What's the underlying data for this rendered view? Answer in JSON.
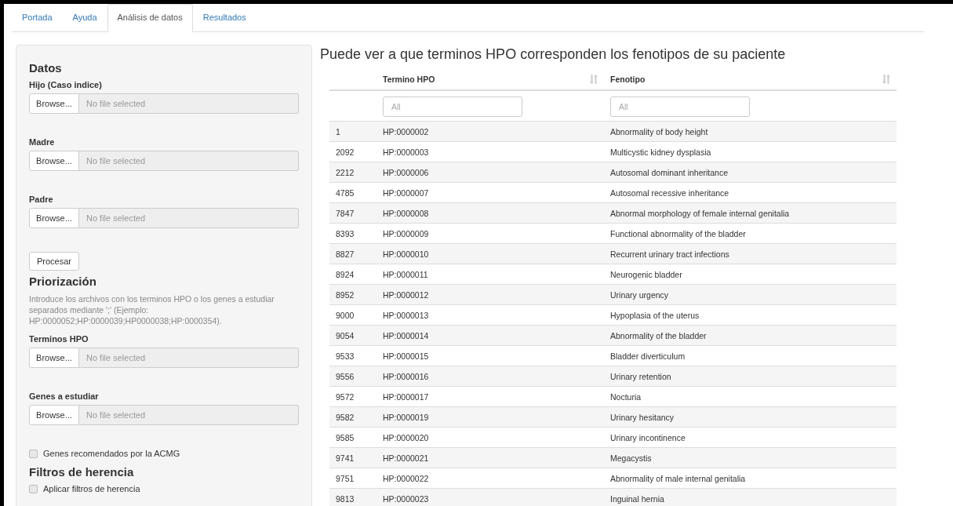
{
  "tabs": [
    {
      "label": "Portada",
      "selected": false
    },
    {
      "label": "Ayuda",
      "selected": false
    },
    {
      "label": "Análisis de datos",
      "selected": true
    },
    {
      "label": "Resultados",
      "selected": false
    }
  ],
  "sidebar": {
    "items": [
      {
        "kind": "heading",
        "text": "Datos"
      },
      {
        "kind": "file",
        "label": "Hijo (Caso indice)",
        "button": "Browse...",
        "placeholder": "No file selected"
      },
      {
        "kind": "file",
        "label": "Madre",
        "button": "Browse...",
        "placeholder": "No file selected"
      },
      {
        "kind": "file",
        "label": "Padre",
        "button": "Browse...",
        "placeholder": "No file selected"
      },
      {
        "kind": "button",
        "text": "Procesar"
      },
      {
        "kind": "heading",
        "text": "Priorización"
      },
      {
        "kind": "help",
        "text": "Introduce los archivos con los terminos HPO o los genes a estudiar separados mediante ';' (Ejemplo: HP:0000052;HP:0000039;HP0000038;HP:0000354)."
      },
      {
        "kind": "file",
        "label": "Terminos HPO",
        "button": "Browse...",
        "placeholder": "No file selected"
      },
      {
        "kind": "file",
        "label": "Genes a estudiar",
        "button": "Browse...",
        "placeholder": "No file selected"
      },
      {
        "kind": "checkbox",
        "text": "Genes recomendados por la ACMG",
        "checked": false
      },
      {
        "kind": "heading",
        "text": "Filtros de herencia"
      },
      {
        "kind": "checkbox",
        "text": "Aplicar filtros de herencia",
        "checked": false
      }
    ]
  },
  "main": {
    "title": "Puede ver a que terminos HPO corresponden los fenotipos de su paciente",
    "table": {
      "columns": [
        "",
        "Termino HPO",
        "Fenotipo"
      ],
      "filters": [
        {
          "placeholder": "All"
        },
        {
          "placeholder": "All"
        }
      ],
      "rows": [
        [
          "1",
          "HP:0000002",
          "Abnormality of body height"
        ],
        [
          "2092",
          "HP:0000003",
          "Multicystic kidney dysplasia"
        ],
        [
          "2212",
          "HP:0000006",
          "Autosomal dominant inheritance"
        ],
        [
          "4785",
          "HP:0000007",
          "Autosomal recessive inheritance"
        ],
        [
          "7847",
          "HP:0000008",
          "Abnormal morphology of female internal genitalia"
        ],
        [
          "8393",
          "HP:0000009",
          "Functional abnormality of the bladder"
        ],
        [
          "8827",
          "HP:0000010",
          "Recurrent urinary tract infections"
        ],
        [
          "8924",
          "HP:0000011",
          "Neurogenic bladder"
        ],
        [
          "8952",
          "HP:0000012",
          "Urinary urgency"
        ],
        [
          "9000",
          "HP:0000013",
          "Hypoplasia of the uterus"
        ],
        [
          "9054",
          "HP:0000014",
          "Abnormality of the bladder"
        ],
        [
          "9533",
          "HP:0000015",
          "Bladder diverticulum"
        ],
        [
          "9556",
          "HP:0000016",
          "Urinary retention"
        ],
        [
          "9572",
          "HP:0000017",
          "Nocturia"
        ],
        [
          "9582",
          "HP:0000019",
          "Urinary hesitancy"
        ],
        [
          "9585",
          "HP:0000020",
          "Urinary incontinence"
        ],
        [
          "9741",
          "HP:0000021",
          "Megacystis"
        ],
        [
          "9751",
          "HP:0000022",
          "Abnormality of male internal genitalia"
        ],
        [
          "9813",
          "HP:0000023",
          "Inguinal hernia"
        ]
      ]
    }
  }
}
